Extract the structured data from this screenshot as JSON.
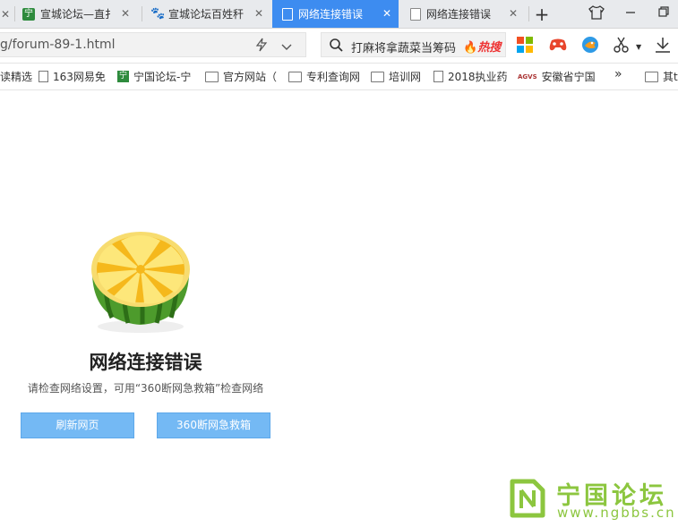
{
  "tabs": [
    {
      "title": "宣城论坛—直扌",
      "icon": "ningguo-favicon-icon",
      "icon_text": "宁",
      "active": false
    },
    {
      "title": "宣城论坛百姓秆",
      "icon": "baidu-paw-icon",
      "active": false
    },
    {
      "title": "网络连接错误",
      "icon": "page-icon",
      "active": true
    },
    {
      "title": "网络连接错误",
      "icon": "page-icon",
      "active": false
    }
  ],
  "new_tab_label": "+",
  "address": {
    "url": "g/forum-89-1.html"
  },
  "search": {
    "query": "打麻将拿蔬菜当筹码",
    "hot_label": "热搜"
  },
  "bookmarks": [
    {
      "label": "读精选",
      "icon": "none"
    },
    {
      "label": "163网易免",
      "icon": "page"
    },
    {
      "label": "宁国论坛-宁",
      "icon": "green",
      "icon_text": "宁"
    },
    {
      "label": "官方网站（",
      "icon": "folder"
    },
    {
      "label": "专利查询网",
      "icon": "folder"
    },
    {
      "label": "培训网",
      "icon": "folder"
    },
    {
      "label": "2018执业药",
      "icon": "page"
    },
    {
      "label": "安徽省宁国",
      "icon": "agvs",
      "icon_text": "AGVS"
    },
    {
      "label": "其t",
      "icon": "folder"
    }
  ],
  "bookmarks_more": "»",
  "error": {
    "title": "网络连接错误",
    "description": "请检查网络设置，可用“360断网急救箱”检查网络",
    "refresh_button": "刷新网页",
    "rescue_button": "360断网急救箱"
  },
  "watermark": {
    "cn": "宁国论坛",
    "en": "www.ngbbs.cn"
  },
  "colors": {
    "accent": "#3d8cf0",
    "button": "#74b9f4",
    "watermark": "#8cc63f",
    "hot": "#e33333"
  }
}
